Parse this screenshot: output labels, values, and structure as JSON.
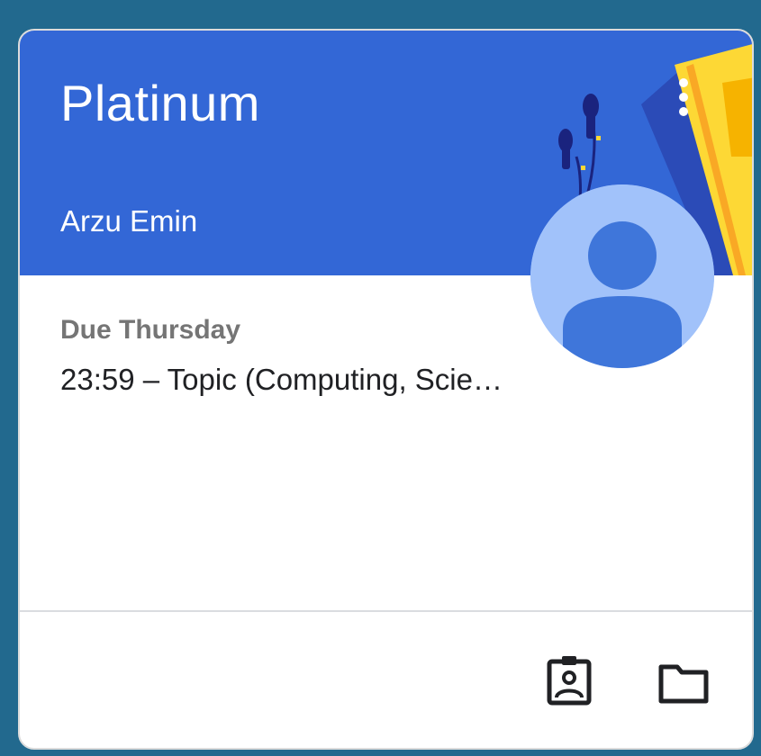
{
  "class_card": {
    "title": "Platinum",
    "teacher": "Arzu Emin",
    "due": {
      "label": "Due Thursday",
      "assignment": "23:59 – Topic (Computing, Scie…"
    },
    "icons": {
      "menu": "more-vert-icon",
      "profile": "assignment-ind-icon",
      "folder": "folder-icon",
      "avatar": "default-avatar-icon"
    },
    "colors": {
      "header": "#3367d6",
      "background": "#22698e",
      "avatar_bg": "#a1c2fa",
      "avatar_fg": "#3f76da"
    }
  }
}
